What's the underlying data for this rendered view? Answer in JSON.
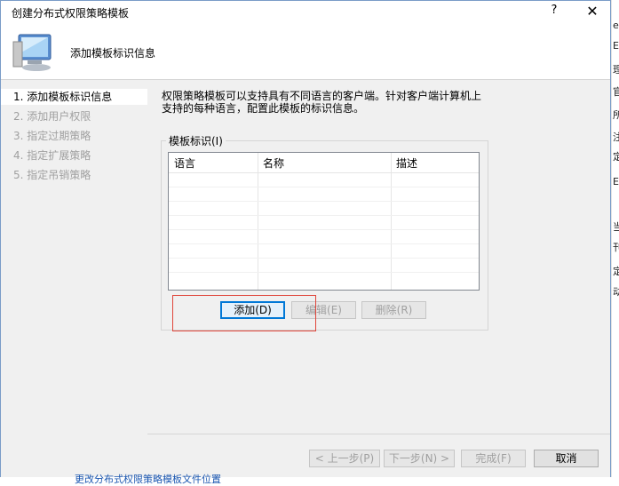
{
  "window": {
    "title": "创建分布式权限策略模板",
    "help_glyph": "?",
    "close_glyph": "✕"
  },
  "header": {
    "title": "添加模板标识信息",
    "icon": "computer-monitor-icon"
  },
  "steps": [
    {
      "label": "1.  添加模板标识信息",
      "active": true
    },
    {
      "label": "2.  添加用户权限",
      "active": false
    },
    {
      "label": "3.  指定过期策略",
      "active": false
    },
    {
      "label": "4.  指定扩展策略",
      "active": false
    },
    {
      "label": "5.  指定吊销策略",
      "active": false
    }
  ],
  "main": {
    "description_line1": "权限策略模板可以支持具有不同语言的客户端。针对客户端计算机上",
    "description_line2": "支持的每种语言，配置此模板的标识信息。",
    "group_label": "模板标识(I)",
    "columns": [
      "语言",
      "名称",
      "描述"
    ],
    "add_button": "添加(D)",
    "edit_button": "编辑(E)",
    "delete_button": "删除(R)"
  },
  "footer": {
    "back_button": "< 上一步(P)",
    "next_button": "下一步(N) >",
    "finish_button": "完成(F)",
    "cancel_button": "取消"
  },
  "background": {
    "right_chars": [
      "e",
      "E",
      "理",
      "官",
      "所",
      "注",
      "定",
      "E",
      "当",
      "刊",
      "定",
      "动"
    ],
    "bottom_text": "更改分布式权限策略模板文件位置"
  },
  "colors": {
    "accent": "#0078d7",
    "highlight": "#e0453a",
    "panel": "#f0f0f0"
  }
}
